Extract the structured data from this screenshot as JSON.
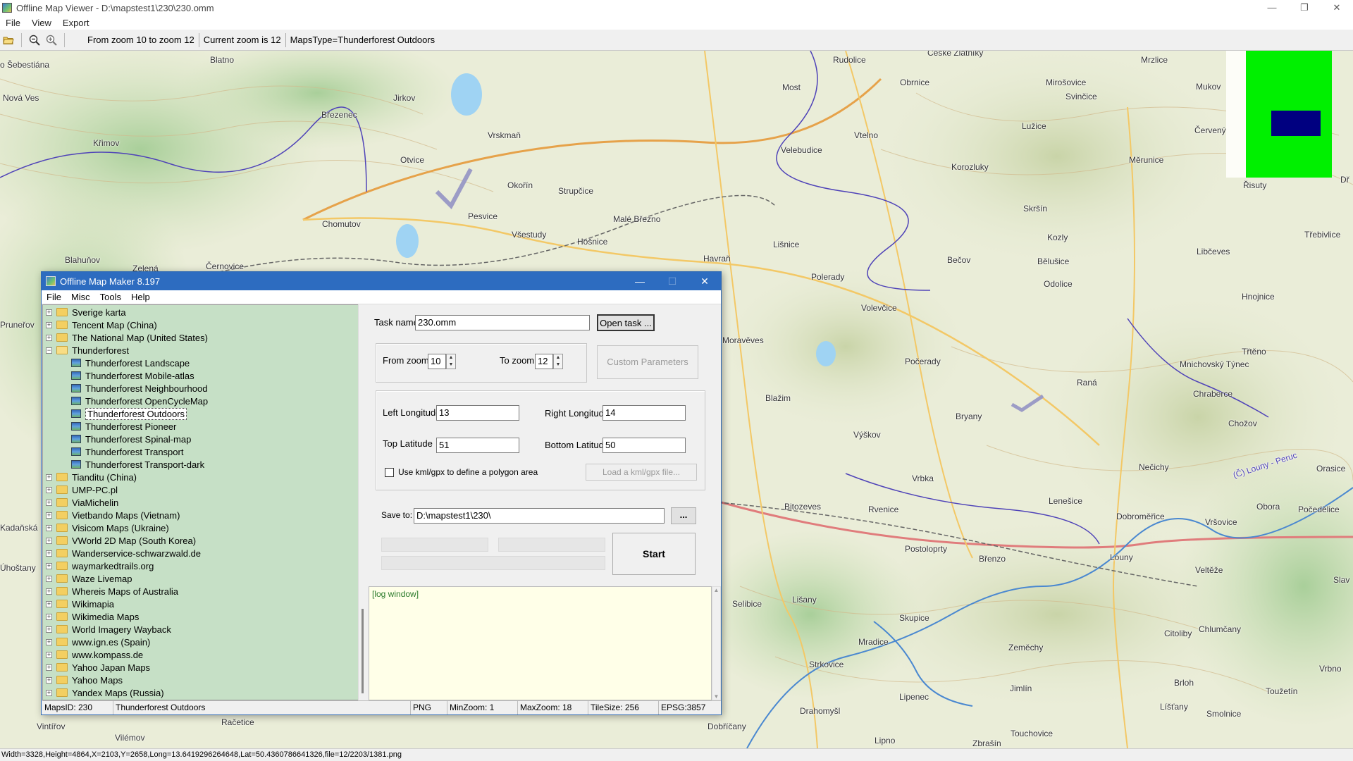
{
  "window": {
    "title": "Offline Map Viewer - D:\\mapstest1\\230\\230.omm",
    "controls": [
      "—",
      "❐",
      "✕"
    ]
  },
  "menu": [
    "File",
    "View",
    "Export"
  ],
  "toolbar": {
    "icons": [
      "open-folder-icon",
      "zoom-out-icon",
      "zoom-in-icon"
    ],
    "zoom_range": "From zoom 10 to zoom 12",
    "current_zoom": "Current zoom is 12",
    "maps_type": "MapsType=Thunderforest Outdoors"
  },
  "map": {
    "labels": [
      "o Šebestiána",
      "Blatno",
      "Rudolice",
      "Ceské Zlatníky",
      "Mrzlice",
      "Nová Ves",
      "Jirkov",
      "Most",
      "Obrnice",
      "Mirošovice",
      "Mukov",
      "Březenec",
      "Svinčice",
      "Vrskmaň",
      "Vtelno",
      "Lužice",
      "Červený",
      "Křimov",
      "Velebudice",
      "Otvice",
      "Korozluky",
      "Měrunice",
      "Řisuty",
      "Okořín",
      "Strupčice",
      "Skršín",
      "Pesvice",
      "Chomutov",
      "Malé Březno",
      "Všestudy",
      "Hošnice",
      "Kozly",
      "Třebivlice",
      "Blahuňov",
      "Zelená",
      "Černovice",
      "Havraň",
      "Lišnice",
      "Libčeves",
      "Bečov",
      "Bělušice",
      "Polerady",
      "Odolice",
      "Hnojnice",
      "Volevčice",
      "Moravěves",
      "Počerady",
      "Třtěno",
      "Mnichovský Týnec",
      "Raná",
      "Chraberce",
      "Blažim",
      "Chožov",
      "Bryany",
      "Výškov",
      "Nečichy",
      "Vrbka",
      "Lenešice",
      "Bitozeves",
      "Rvenice",
      "Dobroměřice",
      "Vršovice",
      "Obora",
      "Počedělice",
      "Postoloprty",
      "Louny",
      "Břenzo",
      "Veltěže",
      "Selibice",
      "Lišany",
      "Skupice",
      "Citoliby",
      "Chlumčany",
      "Mradice",
      "Zeměchy",
      "Strkovice",
      "Jimlín",
      "Brloh",
      "Toužetín",
      "Lipenec",
      "Líšťany",
      "Drahomyšl",
      "Touchovice",
      "Smolnice",
      "Dobříčany",
      "Lipno",
      "Zbrašín",
      "Račetice",
      "Vilémov",
      "Vintířov",
      "Úhoštany",
      "Kadaňská",
      "Pruneřov",
      "Orasice",
      "Vrbno",
      "Slav",
      "Dř",
      "(Č) Louny - Peruc"
    ],
    "minimap_colors": {
      "background": "#00f000",
      "viewport": "#000080"
    }
  },
  "status_bar": "Width=3328,Height=4864,X=2103,Y=2658,Long=13.6419296264648,Lat=50.4360786641326,file=12/2203/1381.png",
  "dialog": {
    "title": "Offline Map Maker 8.197",
    "menu": [
      "File",
      "Misc",
      "Tools",
      "Help"
    ],
    "tree": [
      {
        "label": "Sverige karta",
        "expander": "+",
        "type": "folder"
      },
      {
        "label": "Tencent Map (China)",
        "expander": "+",
        "type": "folder"
      },
      {
        "label": "The National Map (United States)",
        "expander": "+",
        "type": "folder"
      },
      {
        "label": "Thunderforest",
        "expander": "−",
        "type": "folder-open"
      },
      {
        "label": "Thunderforest Landscape",
        "type": "map",
        "child": true
      },
      {
        "label": "Thunderforest Mobile-atlas",
        "type": "map",
        "child": true
      },
      {
        "label": "Thunderforest Neighbourhood",
        "type": "map",
        "child": true
      },
      {
        "label": "Thunderforest OpenCycleMap",
        "type": "map",
        "child": true
      },
      {
        "label": "Thunderforest Outdoors",
        "type": "map",
        "child": true,
        "selected": true
      },
      {
        "label": "Thunderforest Pioneer",
        "type": "map",
        "child": true
      },
      {
        "label": "Thunderforest Spinal-map",
        "type": "map",
        "child": true
      },
      {
        "label": "Thunderforest Transport",
        "type": "map",
        "child": true
      },
      {
        "label": "Thunderforest Transport-dark",
        "type": "map",
        "child": true
      },
      {
        "label": "Tianditu (China)",
        "expander": "+",
        "type": "folder"
      },
      {
        "label": "UMP-PC.pl",
        "expander": "+",
        "type": "folder"
      },
      {
        "label": "ViaMichelin",
        "expander": "+",
        "type": "folder"
      },
      {
        "label": "Vietbando Maps (Vietnam)",
        "expander": "+",
        "type": "folder"
      },
      {
        "label": "Visicom Maps (Ukraine)",
        "expander": "+",
        "type": "folder"
      },
      {
        "label": "VWorld 2D Map (South Korea)",
        "expander": "+",
        "type": "folder"
      },
      {
        "label": "Wanderservice-schwarzwald.de",
        "expander": "+",
        "type": "folder"
      },
      {
        "label": "waymarkedtrails.org",
        "expander": "+",
        "type": "folder"
      },
      {
        "label": "Waze Livemap",
        "expander": "+",
        "type": "folder"
      },
      {
        "label": "Whereis Maps of Australia",
        "expander": "+",
        "type": "folder"
      },
      {
        "label": "Wikimapia",
        "expander": "+",
        "type": "folder"
      },
      {
        "label": "Wikimedia Maps",
        "expander": "+",
        "type": "folder"
      },
      {
        "label": "World Imagery Wayback",
        "expander": "+",
        "type": "folder"
      },
      {
        "label": "www.ign.es (Spain)",
        "expander": "+",
        "type": "folder"
      },
      {
        "label": "www.kompass.de",
        "expander": "+",
        "type": "folder"
      },
      {
        "label": "Yahoo Japan Maps",
        "expander": "+",
        "type": "folder"
      },
      {
        "label": "Yahoo Maps",
        "expander": "+",
        "type": "folder"
      },
      {
        "label": "Yandex Maps (Russia)",
        "expander": "+",
        "type": "folder"
      }
    ],
    "task_name_label": "Task name",
    "task_name_value": "230.omm",
    "open_task_button": "Open task ...",
    "from_zoom_label": "From zoom",
    "from_zoom_value": "10",
    "to_zoom_label": "To zoom",
    "to_zoom_value": "12",
    "custom_params_button": "Custom Parameters",
    "left_lon_label": "Left Longitude",
    "left_lon_value": "13",
    "right_lon_label": "Right Longitude",
    "right_lon_value": "14",
    "top_lat_label": "Top Latitude",
    "top_lat_value": "51",
    "bottom_lat_label": "Bottom Latitude",
    "bottom_lat_value": "50",
    "kml_checkbox_label": "Use kml/gpx to define a polygon area",
    "load_kml_button": "Load a kml/gpx file...",
    "save_to_label": "Save to:",
    "save_to_value": "D:\\mapstest1\\230\\",
    "browse_button": "...",
    "start_button": "Start",
    "log_text": "[log window]",
    "status": [
      "MapsID: 230",
      "Thunderforest Outdoors",
      "PNG",
      "MinZoom: 1",
      "MaxZoom: 18",
      "TileSize: 256",
      "EPSG:3857"
    ]
  }
}
